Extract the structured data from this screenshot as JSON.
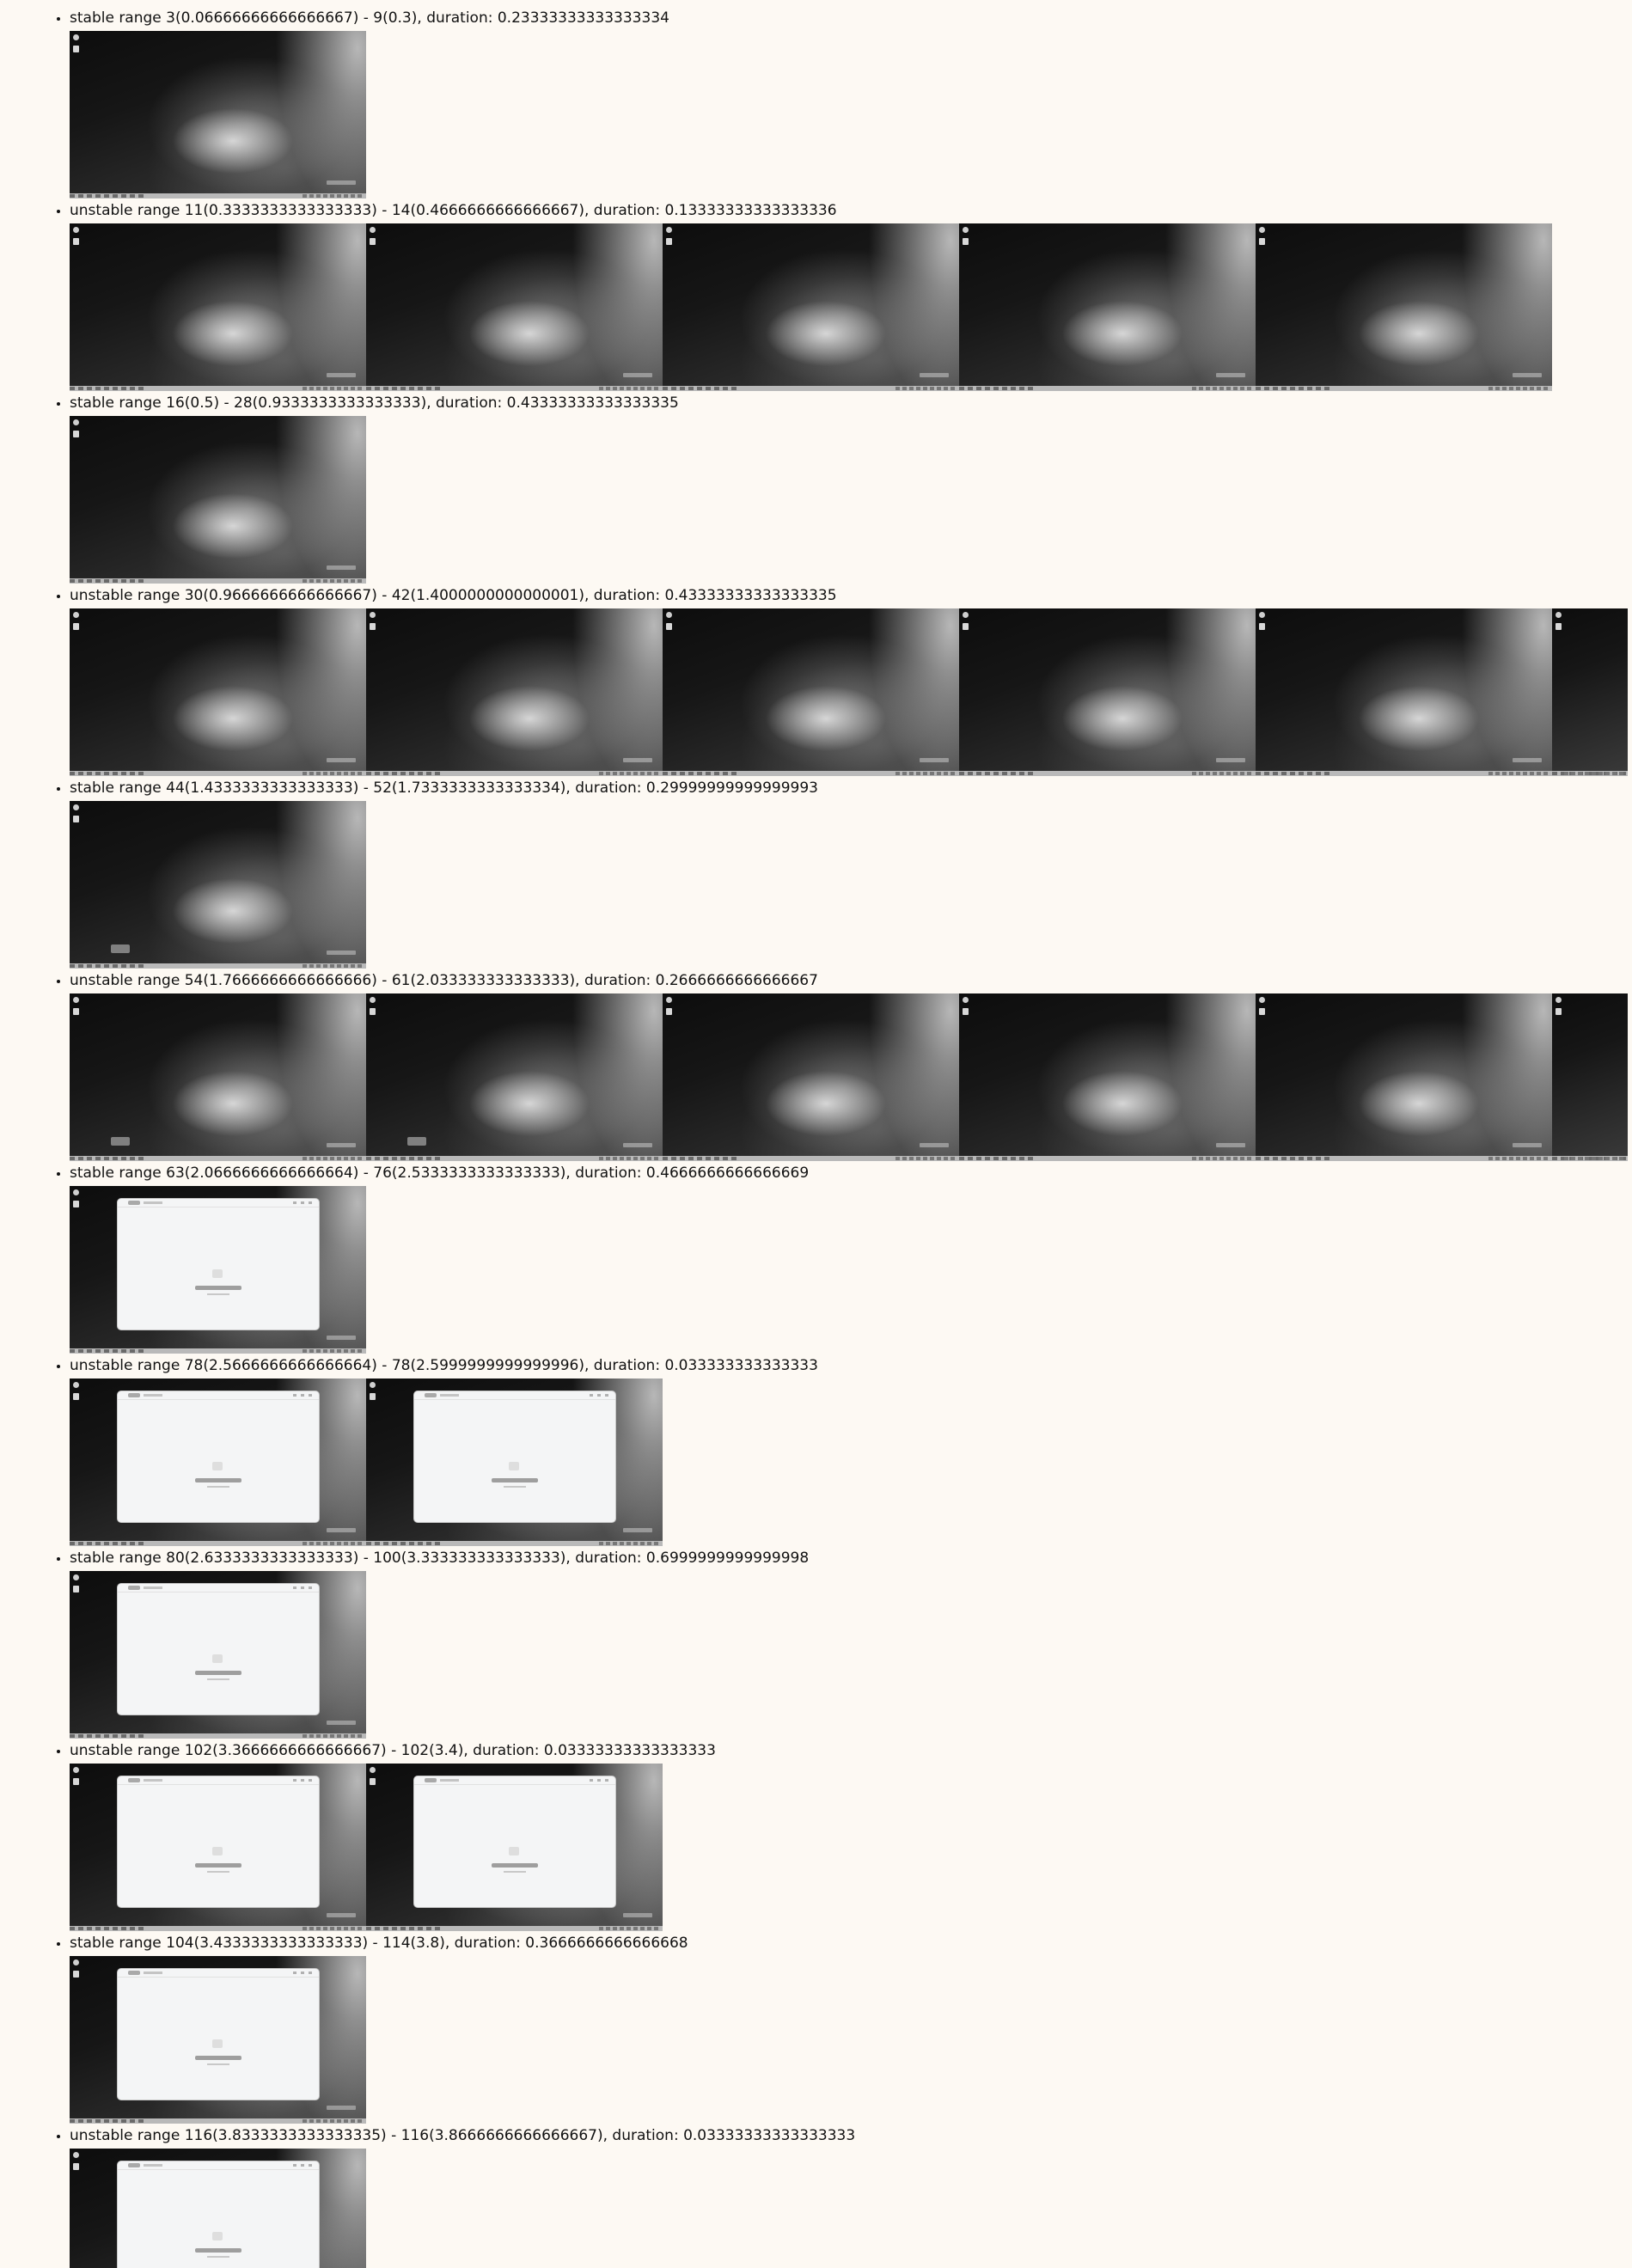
{
  "ranges": [
    {
      "label": "stable range 3(0.06666666666666667) - 9(0.3), duration: 0.23333333333333334",
      "frames": [
        {
          "scene": "desktop"
        }
      ]
    },
    {
      "label": "unstable range 11(0.3333333333333333) - 14(0.4666666666666667), duration: 0.13333333333333336",
      "frames": [
        {
          "scene": "desktop"
        },
        {
          "scene": "desktop"
        },
        {
          "scene": "desktop"
        },
        {
          "scene": "desktop"
        },
        {
          "scene": "desktop"
        }
      ]
    },
    {
      "label": "stable range 16(0.5) - 28(0.9333333333333333), duration: 0.43333333333333335",
      "frames": [
        {
          "scene": "desktop"
        }
      ]
    },
    {
      "label": "unstable range 30(0.9666666666666667) - 42(1.4000000000000001), duration: 0.43333333333333335",
      "frames": [
        {
          "scene": "desktop"
        },
        {
          "scene": "desktop"
        },
        {
          "scene": "desktop"
        },
        {
          "scene": "desktop"
        },
        {
          "scene": "desktop"
        },
        {
          "scene": "desktop-partial"
        }
      ]
    },
    {
      "label": "stable range 44(1.4333333333333333) - 52(1.7333333333333334), duration: 0.29999999999999993",
      "frames": [
        {
          "scene": "desktop-popup"
        }
      ]
    },
    {
      "label": "unstable range 54(1.7666666666666666) - 61(2.033333333333333), duration: 0.2666666666666667",
      "frames": [
        {
          "scene": "desktop-popup"
        },
        {
          "scene": "desktop-popup"
        },
        {
          "scene": "desktop"
        },
        {
          "scene": "desktop"
        },
        {
          "scene": "desktop"
        },
        {
          "scene": "desktop-partial"
        }
      ]
    },
    {
      "label": "stable range 63(2.0666666666666664) - 76(2.5333333333333333), duration: 0.4666666666666669",
      "frames": [
        {
          "scene": "app-window"
        }
      ]
    },
    {
      "label": "unstable range 78(2.5666666666666664) - 78(2.5999999999999996), duration: 0.033333333333333",
      "frames": [
        {
          "scene": "app-window"
        },
        {
          "scene": "app-window"
        }
      ]
    },
    {
      "label": "stable range 80(2.6333333333333333) - 100(3.333333333333333), duration: 0.6999999999999998",
      "frames": [
        {
          "scene": "app-window"
        }
      ]
    },
    {
      "label": "unstable range 102(3.3666666666666667) - 102(3.4), duration: 0.03333333333333333",
      "frames": [
        {
          "scene": "app-window"
        },
        {
          "scene": "app-window"
        }
      ]
    },
    {
      "label": "stable range 104(3.4333333333333333) - 114(3.8), duration: 0.3666666666666668",
      "frames": [
        {
          "scene": "app-window"
        }
      ]
    },
    {
      "label": "unstable range 116(3.8333333333333335) - 116(3.8666666666666667), duration: 0.03333333333333333",
      "frames": [
        {
          "scene": "app-window"
        }
      ]
    }
  ]
}
